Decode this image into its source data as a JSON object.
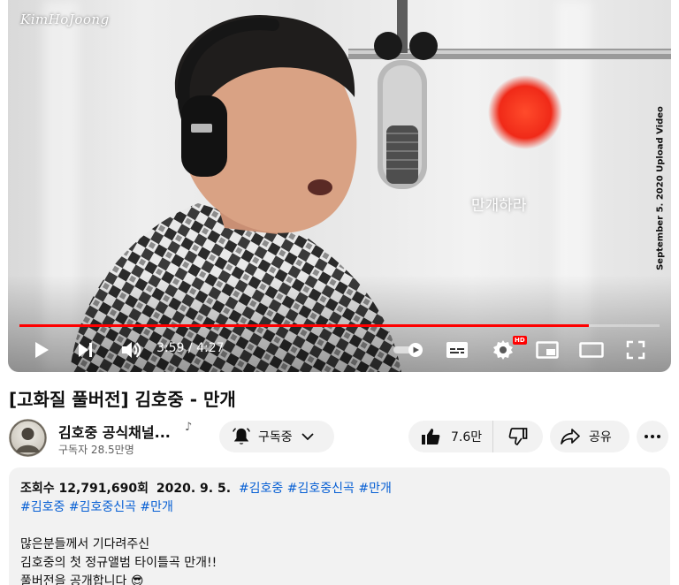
{
  "player": {
    "watermark": "KimHoJoong",
    "side_caption": "September 5. 2020 Upload Video",
    "lyric_subtitle": "만개하라",
    "progress_fraction": 0.89,
    "time_current": "3:59",
    "time_separator": "/",
    "time_total": "4:27",
    "hd_badge": "HD",
    "icons": [
      "play-icon",
      "next-icon",
      "volume-icon",
      "autoplay-toggle",
      "subtitles-icon",
      "settings-icon",
      "miniplayer-icon",
      "theater-icon",
      "fullscreen-icon"
    ]
  },
  "video": {
    "title": "[고화질 풀버전] 김호중 - 만개"
  },
  "channel": {
    "name": "김호중 공식채널...",
    "subscribers": "구독자 28.5만명"
  },
  "actions": {
    "subscribe_label": "구독중",
    "like_count": "7.6만",
    "share_label": "공유"
  },
  "description": {
    "views": "조회수 12,791,690회",
    "date": "2020. 9. 5.",
    "meta_tags": [
      "#김호중",
      "#김호중신곡",
      "#만개"
    ],
    "tags": [
      "#김호중",
      "#김호중신곡",
      "#만개"
    ],
    "lines": [
      "많은분들께서 기다려주신",
      "김호중의 첫 정규앨범 타이틀곡 만개!!",
      "풀버전을 공개합니다 😎"
    ]
  },
  "colors": {
    "accent": "#ff0000",
    "link": "#065fd4",
    "chip_bg": "#f2f2f2"
  }
}
